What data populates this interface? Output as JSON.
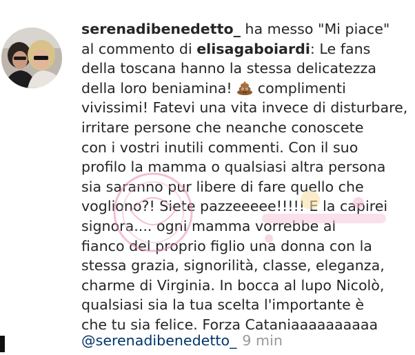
{
  "notification": {
    "actor": "serenadibenedetto_",
    "action_text": " ha messo \"Mi piace\"",
    "line2_prefix": "al commento di ",
    "comment_author": "elisagaboiardi",
    "line2_suffix": ": Le fans",
    "lines": [
      "della toscana hanno la stessa delicatezza",
      "della loro beniamina!",
      " complimenti",
      "vivissimi! Fatevi una vita invece di disturbare,",
      "irritare persone che neanche conoscete",
      "con i vostri inutili commenti. Con il suo",
      "profilo la mamma o qualsiasi altra persona",
      "sia saranno pur libere di fare quello che",
      "vogliono?! Siete pazzeeeee!!!!! E la capirei",
      "signora.... ogni mamma vorrebbe al",
      "fianco del proprio figlio una donna con la",
      "stessa grazia, signorilità, classe, eleganza,",
      "charme di Virginia. In bocca al lupo Nicolò,",
      "qualsiasi sia la tua scelta l'importante è",
      "che tu sia felice. Forza Cataniaaaaaaaaaa"
    ],
    "emoji_icon": "poop-emoji-icon",
    "reply_mention": "@serenadibenedetto_",
    "timestamp": "9 min"
  },
  "colors": {
    "text": "#262626",
    "mention": "#003569",
    "timestamp": "#999999",
    "watermark": "#e88bb5"
  }
}
